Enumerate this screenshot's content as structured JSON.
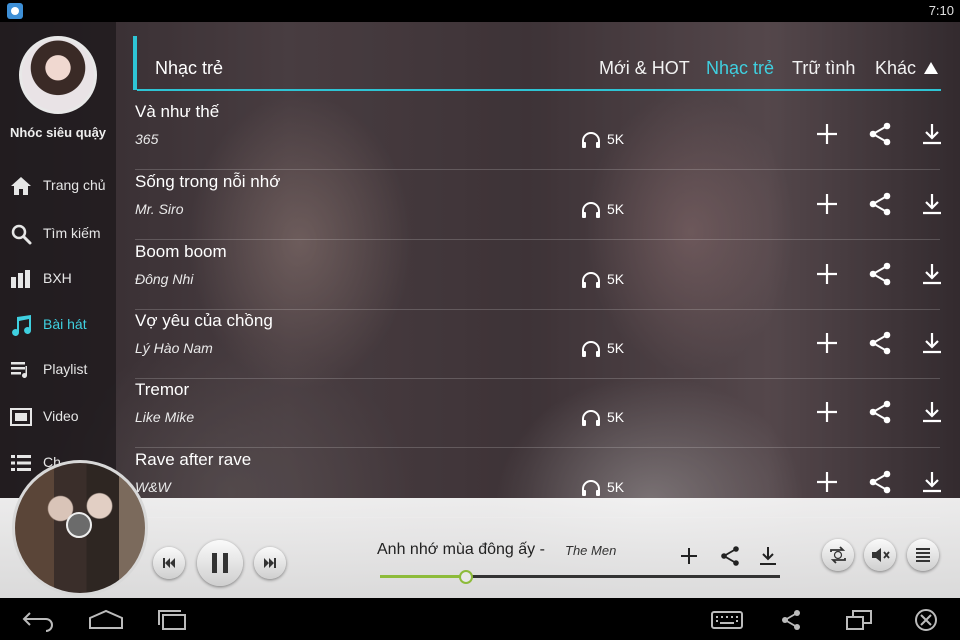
{
  "status_bar": {
    "time": "7:10"
  },
  "user": {
    "name": "Nhóc siêu quậy"
  },
  "sidebar": {
    "items": [
      {
        "label": "Trang chủ",
        "icon": "home-icon",
        "active": false
      },
      {
        "label": "Tìm kiếm",
        "icon": "search-icon",
        "active": false
      },
      {
        "label": "BXH",
        "icon": "bar-chart-icon",
        "active": false
      },
      {
        "label": "Bài hát",
        "icon": "music-note-icon",
        "active": true
      },
      {
        "label": "Playlist",
        "icon": "playlist-icon",
        "active": false
      },
      {
        "label": "Video",
        "icon": "video-icon",
        "active": false
      },
      {
        "label": "Ch",
        "icon": "list-icon",
        "active": false
      }
    ]
  },
  "header": {
    "title": "Nhạc trẻ",
    "tabs": [
      {
        "label": "Mới & HOT",
        "active": false
      },
      {
        "label": "Nhạc trẻ",
        "active": true
      },
      {
        "label": "Trữ tình",
        "active": false
      },
      {
        "label": "Khác",
        "active": false
      }
    ],
    "more_icon": "triangle-up-icon"
  },
  "songs": [
    {
      "title": "Và như thế",
      "artist": "365",
      "plays": "5K"
    },
    {
      "title": "Sống trong nỗi nhớ",
      "artist": "Mr. Siro",
      "plays": "5K"
    },
    {
      "title": "Boom boom",
      "artist": "Đông Nhi",
      "plays": "5K"
    },
    {
      "title": "Vợ yêu của chồng",
      "artist": "Lý Hào Nam",
      "plays": "5K"
    },
    {
      "title": "Tremor",
      "artist": "Like Mike",
      "plays": "5K"
    },
    {
      "title": "Rave after rave",
      "artist": "W&W",
      "plays": "5K"
    }
  ],
  "now_playing": {
    "title": "Anh nhớ mùa đông ấy -",
    "artist": "The Men",
    "progress": 0.215
  },
  "colors": {
    "accent": "#2ec4d4",
    "progress": "#8dbb3a"
  }
}
